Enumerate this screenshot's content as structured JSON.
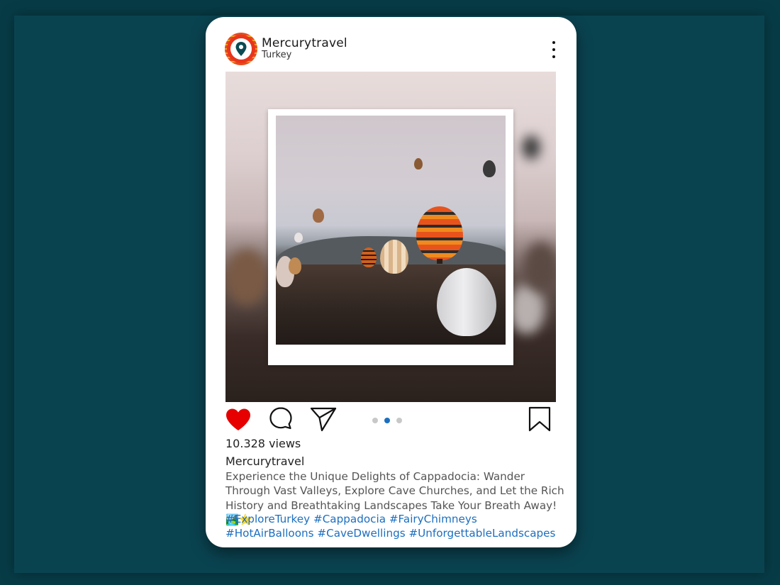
{
  "post": {
    "username": "Mercurytravel",
    "location": "Turkey",
    "views": "10.328 views",
    "caption_username": "Mercurytravel",
    "caption_text": "Experience the Unique Delights of Cappadocia: Wander Through Vast Valleys, Explore Cave Churches, and Let the Rich History and Breathtaking Landscapes Take Your Breath Away! 🏞️⭐",
    "hashtags": "#ExploreTurkey #Cappadocia #FairyChimneys #HotAirBalloons #CaveDwellings #UnforgettableLandscapes",
    "image_subject": "hot air balloons over Cappadocia valley",
    "carousel": {
      "count": 3,
      "active_index": 1
    },
    "liked": true
  },
  "colors": {
    "background": "#073f4a",
    "like": "#e60000",
    "hashtag": "#1b6fc0",
    "carousel_active": "#1b6fc0",
    "carousel_inactive": "#c8c8c8"
  },
  "icons": {
    "avatar": "location-pin-icon",
    "more": "more-vertical-icon",
    "like": "heart-icon",
    "comment": "comment-icon",
    "share": "send-icon",
    "save": "bookmark-icon"
  }
}
